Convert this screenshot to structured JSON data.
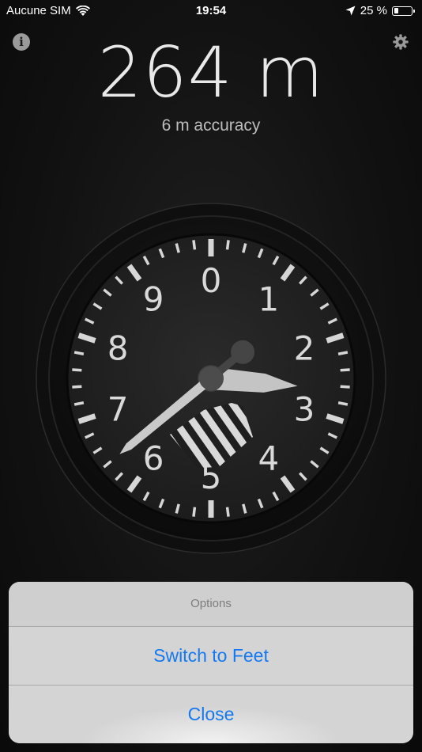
{
  "status_bar": {
    "carrier": "Aucune SIM",
    "time": "19:54",
    "battery": "25 %",
    "battery_level": 0.25,
    "icons": [
      "wifi-icon",
      "location-arrow-icon",
      "battery-icon"
    ]
  },
  "header": {
    "info_icon": "info-icon",
    "settings_icon": "gear-icon"
  },
  "altitude": {
    "value": "264 m",
    "accuracy": "6 m accuracy"
  },
  "gauge": {
    "dial_numbers": [
      "0",
      "1",
      "2",
      "3",
      "4",
      "5",
      "6",
      "7",
      "8",
      "9"
    ],
    "large_hand_value": 0.64,
    "small_hand_value": 0.264
  },
  "action_sheet": {
    "title": "Options",
    "buttons": [
      "Switch to Feet",
      "Close"
    ],
    "accent_color": "#1479f0"
  }
}
